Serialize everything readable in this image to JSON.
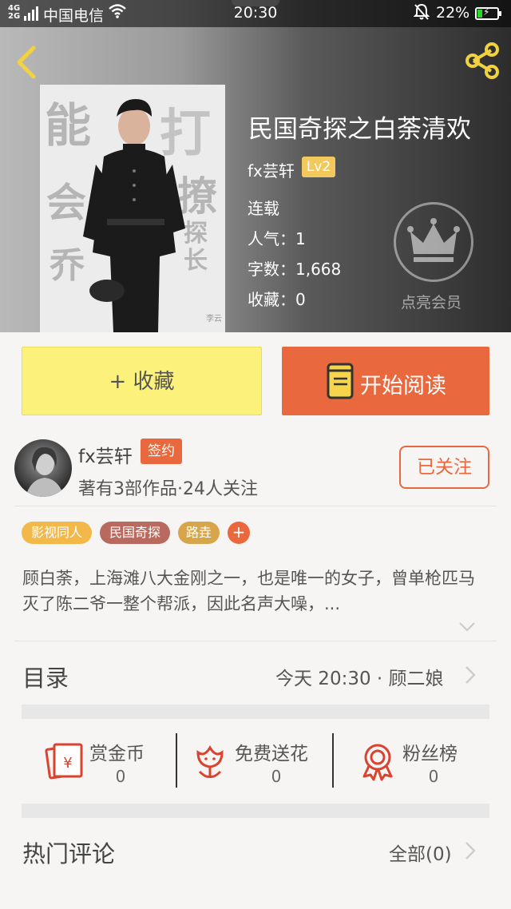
{
  "status_bar": {
    "network": "4G",
    "network2": "2G",
    "carrier": "中国电信",
    "time": "20:30",
    "battery": "22%",
    "battery_fraction": 0.22
  },
  "book": {
    "title": "民国奇探之白荼清欢",
    "author": "fx芸轩",
    "level": "Lv2",
    "status": "连载",
    "popularity": "人气：1",
    "word_count": "字数：1,668",
    "favorites": "收藏：0",
    "vip_label": "点亮会员"
  },
  "cover_text": {
    "c1": "能",
    "c2": "打",
    "c3": "会",
    "c4": "撩",
    "c5": "乔",
    "c6": "探长",
    "c7": "李云"
  },
  "actions": {
    "favorite_label": "+ 收藏",
    "read_label": "开始阅读"
  },
  "author": {
    "name": "fx芸轩",
    "badge": "签约",
    "stats": "著有3部作品·24人关注",
    "follow_label": "已关注"
  },
  "tags": [
    {
      "label": "影视同人",
      "color": "#f2b84a"
    },
    {
      "label": "民国奇探",
      "color": "#b86a5e"
    },
    {
      "label": "路垚",
      "color": "#d8a64a"
    }
  ],
  "tag_add": "+",
  "description": "顾白荼，上海滩八大金刚之一，也是唯一的女子，曾单枪匹马灭了陈二爷一整个帮派，因此名声大噪，...",
  "toc": {
    "title": "目录",
    "latest": "今天 20:30 · 顾二娘"
  },
  "stats": [
    {
      "label": "赏金币",
      "value": "0",
      "icon": "reward-coin-icon"
    },
    {
      "label": "免费送花",
      "value": "0",
      "icon": "flower-icon"
    },
    {
      "label": "粉丝榜",
      "value": "0",
      "icon": "ribbon-medal-icon"
    }
  ],
  "comments": {
    "title": "热门评论",
    "all_label": "全部(0)"
  },
  "colors": {
    "accent": "#e9683e",
    "favorite_button": "#fcf17a",
    "icon_red": "#d9432f",
    "header_yellow": "#f2d23e"
  }
}
